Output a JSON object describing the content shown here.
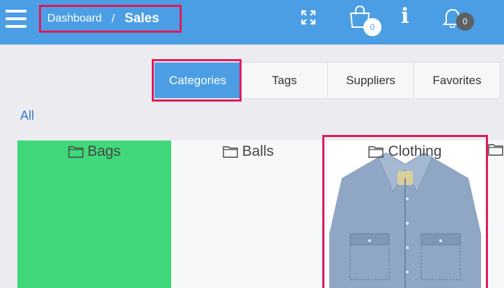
{
  "header": {
    "breadcrumb": {
      "parent": "Dashboard",
      "separator": "/",
      "current": "Sales"
    },
    "icons": [
      "menu-icon",
      "expand-icon",
      "shopping-bag-icon",
      "info-icon",
      "bell-icon"
    ],
    "cart_count": "0",
    "notification_count": "0",
    "info_glyph": "i"
  },
  "tabs": [
    {
      "label": "Categories",
      "active": true
    },
    {
      "label": "Tags",
      "active": false
    },
    {
      "label": "Suppliers",
      "active": false
    },
    {
      "label": "Favorites",
      "active": false
    }
  ],
  "filter": {
    "all_label": "All"
  },
  "categories": [
    {
      "name": "Bags",
      "color": "#41d879"
    },
    {
      "name": "Balls",
      "color": "#f7f8fa"
    },
    {
      "name": "Clothing",
      "image": "denim-shirt"
    }
  ],
  "colors": {
    "header": "#4b9ee4",
    "active_tab": "#4b9ee4",
    "highlight": "#e0195a",
    "link": "#3a78c4"
  }
}
